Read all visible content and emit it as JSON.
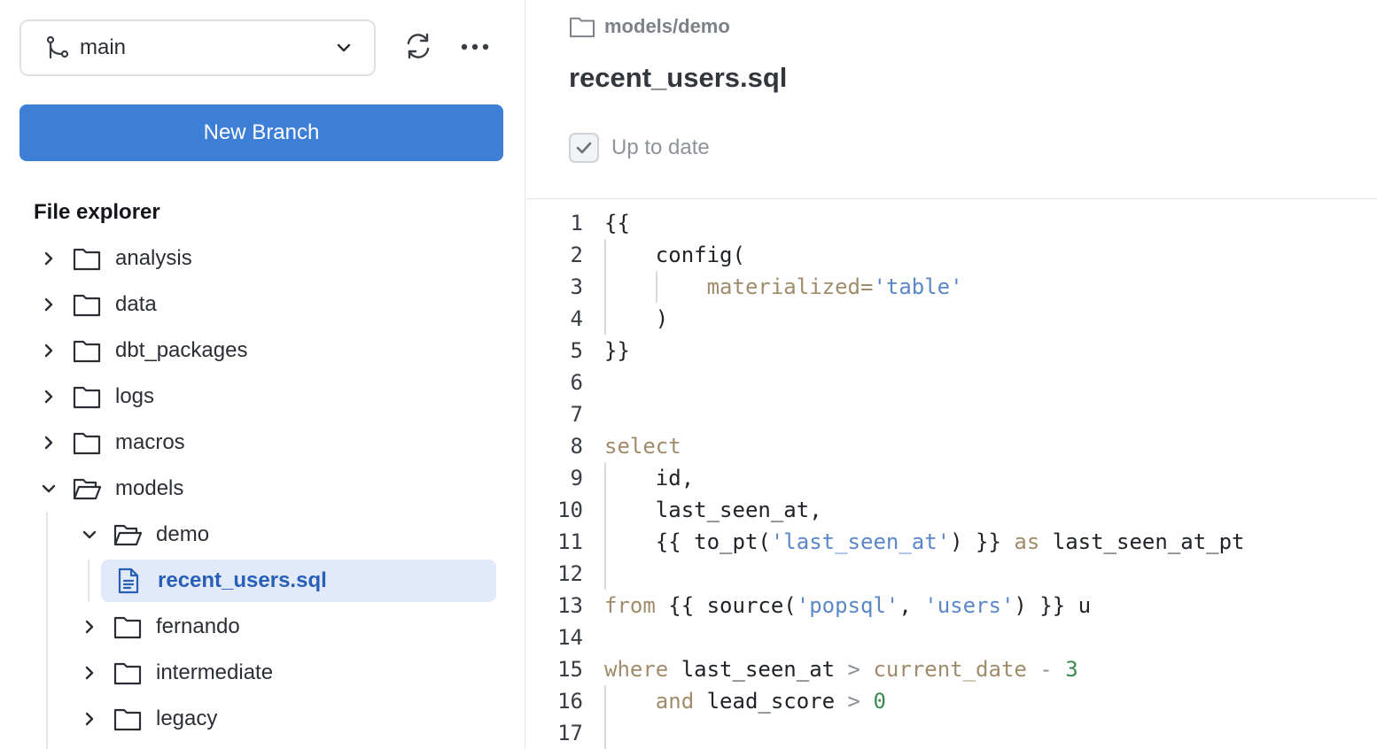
{
  "branch": {
    "name": "main",
    "new_branch_label": "New Branch"
  },
  "file_explorer": {
    "title": "File explorer",
    "folders": [
      {
        "label": "analysis",
        "expanded": false
      },
      {
        "label": "data",
        "expanded": false
      },
      {
        "label": "dbt_packages",
        "expanded": false
      },
      {
        "label": "logs",
        "expanded": false
      },
      {
        "label": "macros",
        "expanded": false
      },
      {
        "label": "models",
        "expanded": true
      }
    ],
    "models_children": [
      {
        "label": "demo",
        "expanded": true
      },
      {
        "label": "fernando",
        "expanded": false
      },
      {
        "label": "intermediate",
        "expanded": false
      },
      {
        "label": "legacy",
        "expanded": false
      }
    ],
    "selected_file": "recent_users.sql"
  },
  "editor_header": {
    "breadcrumb": "models/demo",
    "file_name": "recent_users.sql",
    "status": "Up to date"
  },
  "code": {
    "lines": [
      [
        {
          "t": "{{",
          "c": "plain"
        }
      ],
      [
        {
          "t": "    config(",
          "c": "plain"
        }
      ],
      [
        {
          "t": "        materialized=",
          "c": "kw"
        },
        {
          "t": "'table'",
          "c": "str"
        }
      ],
      [
        {
          "t": "    )",
          "c": "plain"
        }
      ],
      [
        {
          "t": "}}",
          "c": "plain"
        }
      ],
      [],
      [],
      [
        {
          "t": "select",
          "c": "kw"
        }
      ],
      [
        {
          "t": "    id,",
          "c": "plain"
        }
      ],
      [
        {
          "t": "    last_seen_at,",
          "c": "plain"
        }
      ],
      [
        {
          "t": "    {{ to_pt(",
          "c": "plain"
        },
        {
          "t": "'last_seen_at'",
          "c": "str"
        },
        {
          "t": ") }} ",
          "c": "plain"
        },
        {
          "t": "as",
          "c": "kw"
        },
        {
          "t": " last_seen_at_pt",
          "c": "plain"
        }
      ],
      [],
      [
        {
          "t": "from",
          "c": "kw"
        },
        {
          "t": " {{ source(",
          "c": "plain"
        },
        {
          "t": "'popsql'",
          "c": "str"
        },
        {
          "t": ", ",
          "c": "plain"
        },
        {
          "t": "'users'",
          "c": "str"
        },
        {
          "t": ") }} u",
          "c": "plain"
        }
      ],
      [],
      [
        {
          "t": "where",
          "c": "kw"
        },
        {
          "t": " last_seen_at ",
          "c": "plain"
        },
        {
          "t": ">",
          "c": "op"
        },
        {
          "t": " ",
          "c": "plain"
        },
        {
          "t": "current_date",
          "c": "kw"
        },
        {
          "t": " ",
          "c": "plain"
        },
        {
          "t": "-",
          "c": "op"
        },
        {
          "t": " ",
          "c": "plain"
        },
        {
          "t": "3",
          "c": "num"
        }
      ],
      [
        {
          "t": "    and",
          "c": "kw"
        },
        {
          "t": " lead_score ",
          "c": "plain"
        },
        {
          "t": ">",
          "c": "op"
        },
        {
          "t": " ",
          "c": "plain"
        },
        {
          "t": "0",
          "c": "num"
        }
      ],
      []
    ]
  },
  "icons": {
    "branch": "git-branch-icon",
    "chevron": "chevron-down-icon",
    "refresh": "refresh-icon",
    "more": "more-horizontal-icon",
    "folder": "folder-icon",
    "folder_open": "folder-open-icon",
    "file": "file-text-icon",
    "check": "check-icon"
  },
  "colors": {
    "primary": "#3d7ed6",
    "selected_bg": "#e2eaf9",
    "selected_text": "#2860b8",
    "keyword": "#a08c6b",
    "string": "#5b87c9",
    "number": "#3c8a52"
  }
}
